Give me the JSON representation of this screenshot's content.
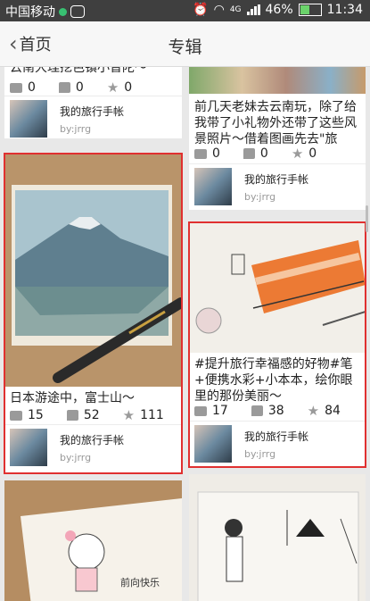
{
  "status_bar": {
    "carrier": "中国移动",
    "network": "4G",
    "battery": "46%",
    "time": "11:34"
  },
  "header": {
    "back_label": "首页",
    "title": "专辑"
  },
  "cards": [
    {
      "caption": "云南大理挖色镇小普陀～",
      "comments": "0",
      "likes": "0",
      "stars": "0",
      "author": "我的旅行手帐",
      "by": "by:jrrg"
    },
    {
      "caption": "前几天老妹去云南玩，除了给我带了小礼物外还带了这些风景照片～借着图画先去\"旅游...",
      "comments": "0",
      "likes": "0",
      "stars": "0",
      "author": "我的旅行手帐",
      "by": "by:jrrg"
    },
    {
      "caption": "日本游途中，富士山～",
      "comments": "15",
      "likes": "52",
      "stars": "111",
      "author": "我的旅行手帐",
      "by": "by:jrrg"
    },
    {
      "caption": "#提升旅行幸福感的好物#笔+便携水彩+小本本，绘你眼里的那份美丽～",
      "comments": "17",
      "likes": "38",
      "stars": "84",
      "author": "我的旅行手帐",
      "by": "by:jrrg"
    }
  ]
}
